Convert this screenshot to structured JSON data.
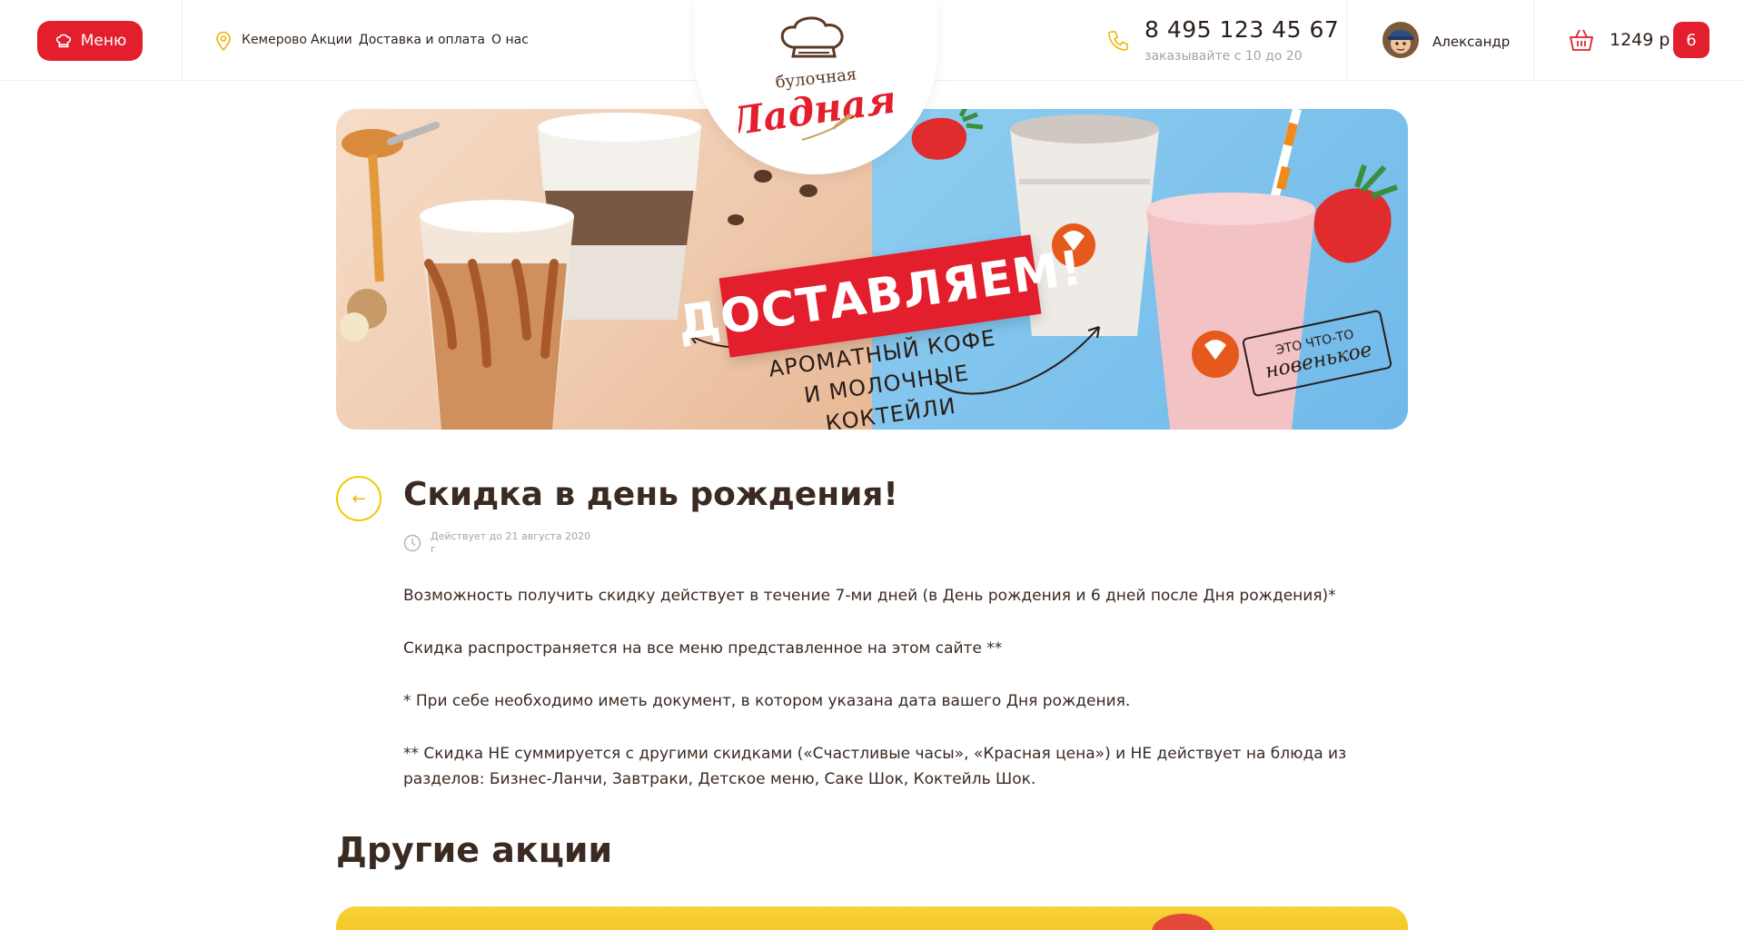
{
  "header": {
    "menu_label": "Меню",
    "city": "Кемерово",
    "nav": [
      "Акции",
      "Доставка и оплата",
      "О нас"
    ],
    "logo": {
      "line1": "булочная",
      "line2": "Ладная"
    },
    "phone": "8 495 123 45 67",
    "phone_hours": "заказывайте с 10 до 20",
    "user_name": "Александр",
    "cart_sum": "1249 р",
    "cart_count": "6"
  },
  "banner": {
    "headline": "ДОСТАВЛЯЕМ!",
    "subline1": "АРОМАТНЫЙ КОФЕ",
    "subline2": "И МОЛОЧНЫЕ КОКТЕЙЛИ",
    "tag_line1": "ЭТО ЧТО-ТО",
    "tag_line2": "новенькое"
  },
  "article": {
    "title": "Скидка в день рождения!",
    "valid_until": "Действует до 21 августа 2020 г",
    "paragraphs": [
      "Возможность получить скидку действует в течение 7-ми дней (в День рождения и 6 дней после Дня рождения)*",
      "Скидка распространяется на все меню представленное на этом сайте **",
      "* При себе необходимо иметь документ, в котором указана дата вашего Дня рождения.",
      "** Скидка НЕ суммируется с другими скидками («Счастливые часы», «Красная цена») и НЕ действует на блюда из разделов: Бизнес-Ланчи, Завтраки, Детское меню, Саке Шок, Коктейль Шок."
    ]
  },
  "other_promos": {
    "title": "Другие акции"
  },
  "colors": {
    "brand_red": "#e31e2d",
    "accent_yellow": "#f6c700",
    "text_dark": "#3a2a22",
    "text_muted": "#a9a29c"
  },
  "icons": [
    "chef-hat-icon",
    "location-pin-icon",
    "phone-icon",
    "cart-icon",
    "arrow-left-icon",
    "clock-icon"
  ]
}
